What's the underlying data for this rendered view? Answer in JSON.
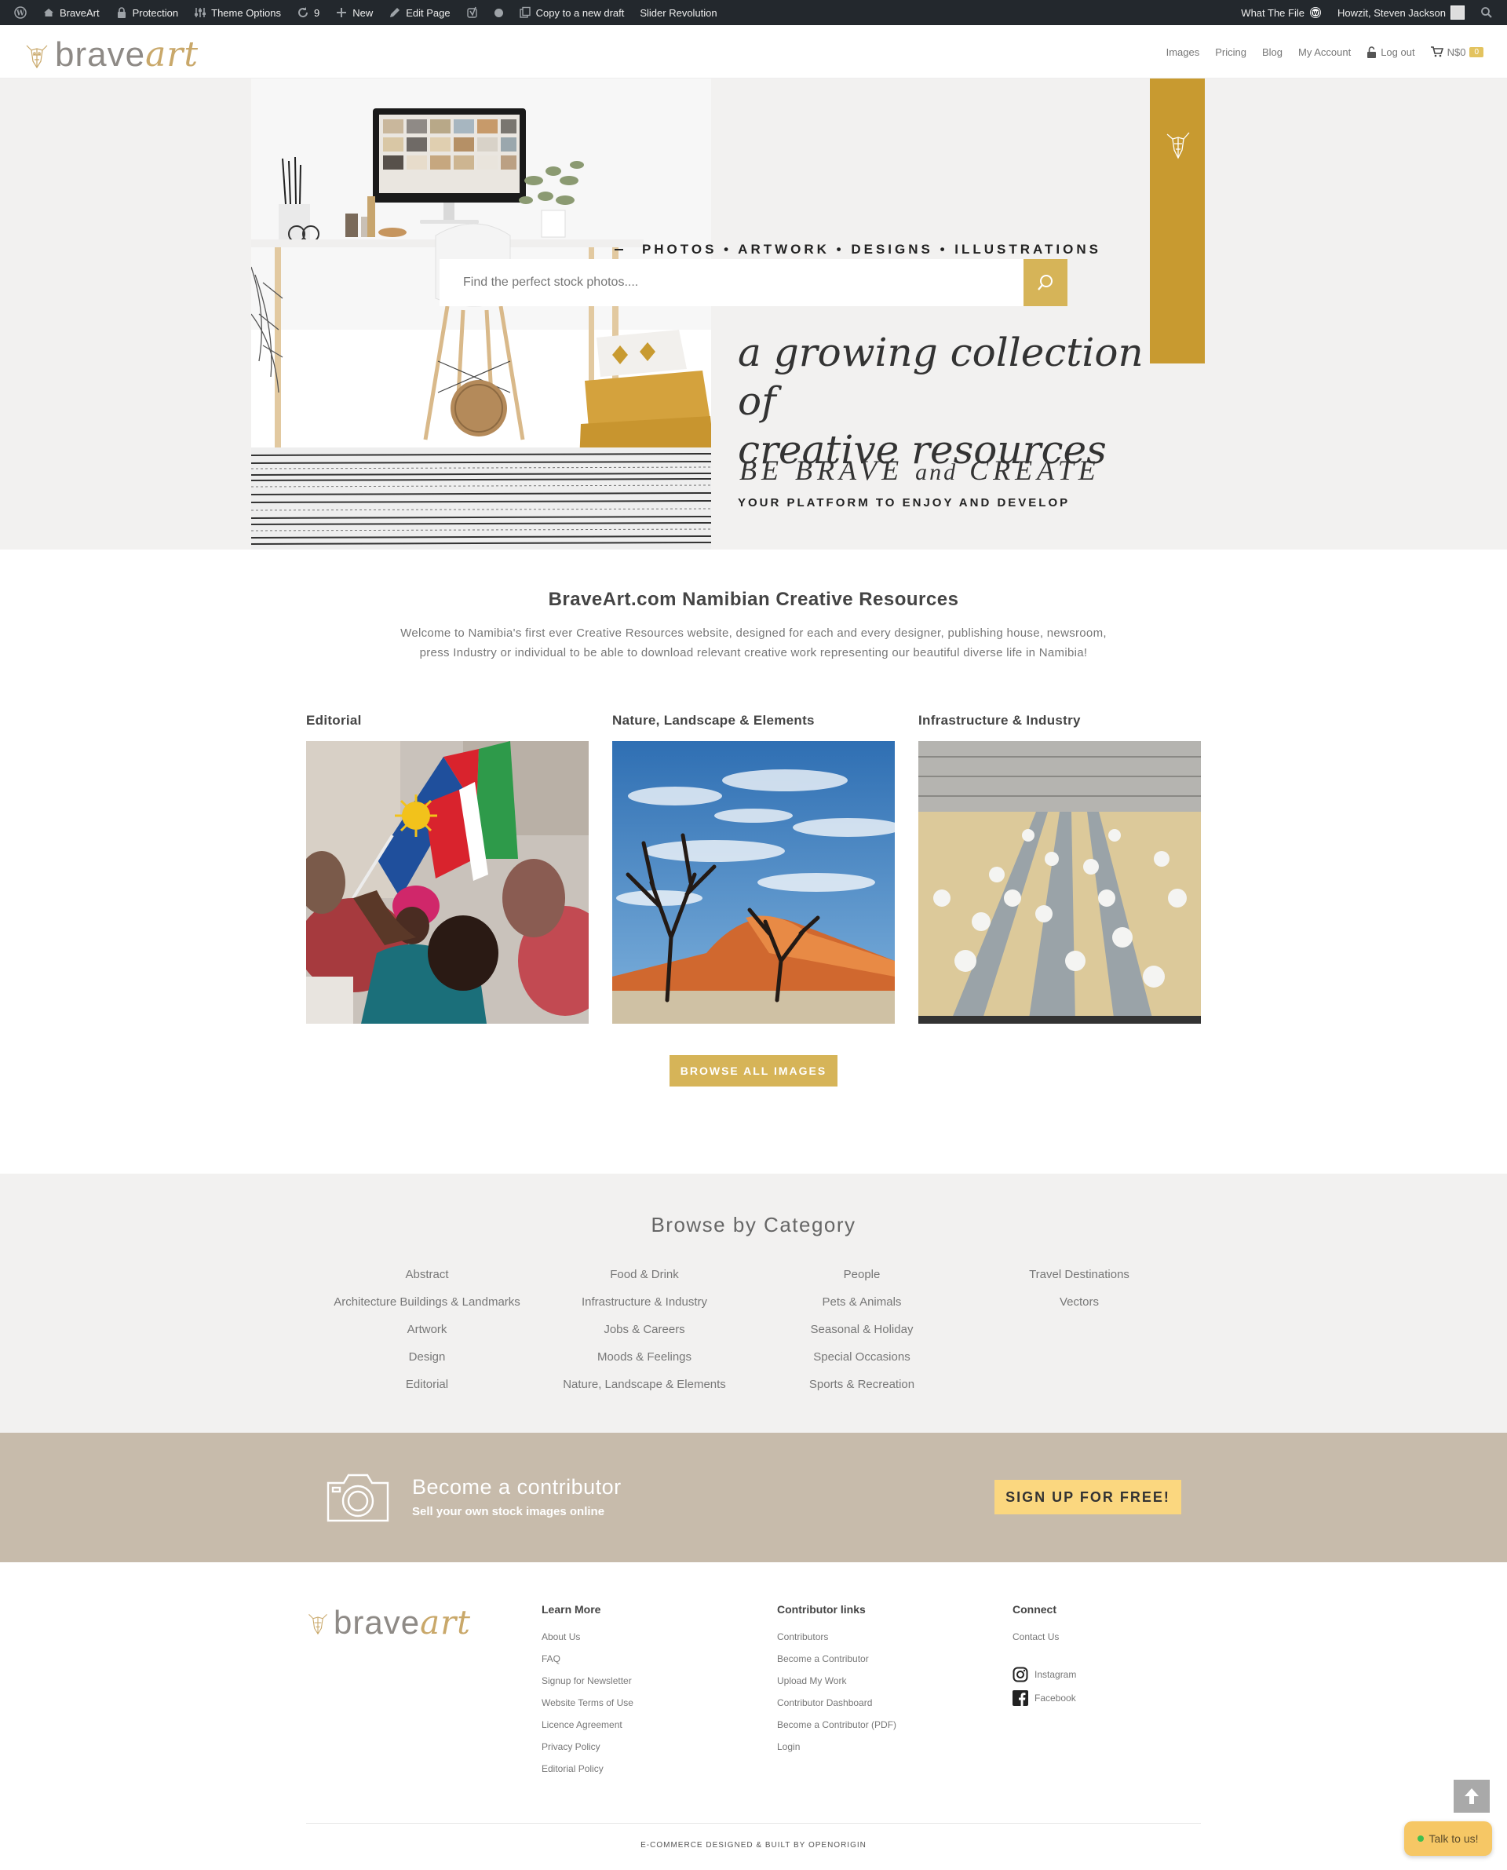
{
  "adminbar": {
    "left": [
      {
        "icon": "wordpress-icon",
        "label": ""
      },
      {
        "icon": "home-icon",
        "label": "BraveArt"
      },
      {
        "icon": "lock-icon",
        "label": "Protection"
      },
      {
        "icon": "sliders-icon",
        "label": "Theme Options"
      },
      {
        "icon": "refresh-icon",
        "label": "9"
      },
      {
        "icon": "plus-icon",
        "label": "New"
      },
      {
        "icon": "pencil-icon",
        "label": "Edit Page"
      },
      {
        "icon": "yoast-icon",
        "label": ""
      },
      {
        "icon": "status-dot-icon",
        "label": ""
      },
      {
        "icon": "copy-icon",
        "label": "Copy to a new draft"
      },
      {
        "icon": "",
        "label": "Slider Revolution"
      }
    ],
    "right": {
      "whatthefile": "What The File",
      "greeting": "Howzit, Steven Jackson"
    }
  },
  "header": {
    "logo_text_brave": "brave",
    "logo_text_art": "art",
    "nav": {
      "images": "Images",
      "pricing": "Pricing",
      "blog": "Blog",
      "account": "My Account",
      "logout": "Log out",
      "cart_total": "N$0",
      "cart_count": "0"
    }
  },
  "hero": {
    "tagline": "PHOTOS • ARTWORK • DESIGNS • ILLUSTRATIONS",
    "search_placeholder": "Find the perfect stock photos....",
    "headline_line1": "a growing collection of",
    "headline_line2": "creative resources",
    "brave_1": "BE BRAVE",
    "brave_and": "and",
    "brave_2": "CREATE",
    "platform": "YOUR PLATFORM TO ENJOY AND DEVELOP"
  },
  "intro": {
    "title": "BraveArt.com Namibian Creative Resources",
    "text": "Welcome to Namibia's first ever Creative Resources website, designed for each and every designer, publishing house, newsroom, press Industry or individual to be able to download relevant creative work representing our beautiful diverse life in Namibia!"
  },
  "featured": [
    {
      "title": "Editorial"
    },
    {
      "title": "Nature, Landscape & Elements"
    },
    {
      "title": "Infrastructure & Industry"
    }
  ],
  "browse_button": "BROWSE ALL IMAGES",
  "browse_by_category": {
    "title": "Browse by Category",
    "columns": [
      [
        "Abstract",
        "Architecture Buildings & Landmarks",
        "Artwork",
        "Design",
        "Editorial"
      ],
      [
        "Food & Drink",
        "Infrastructure & Industry",
        "Jobs & Careers",
        "Moods & Feelings",
        "Nature, Landscape & Elements"
      ],
      [
        "People",
        "Pets & Animals",
        "Seasonal & Holiday",
        "Special Occasions",
        "Sports & Recreation"
      ],
      [
        "Travel Destinations",
        "Vectors"
      ]
    ]
  },
  "contributor": {
    "title": "Become a contributor",
    "subtitle": "Sell your own stock images online",
    "button": "SIGN UP FOR FREE!"
  },
  "footer": {
    "learn_more": {
      "title": "Learn More",
      "links": [
        "About Us",
        "FAQ",
        "Signup for Newsletter",
        "Website Terms of Use",
        "Licence Agreement",
        "Privacy Policy",
        "Editorial Policy"
      ]
    },
    "contributor_links": {
      "title": "Contributor links",
      "links": [
        "Contributors",
        "Become a Contributor",
        "Upload My Work",
        "Contributor Dashboard",
        "Become a Contributor (PDF)",
        "Login"
      ]
    },
    "connect": {
      "title": "Connect",
      "contact": "Contact Us",
      "instagram": "Instagram",
      "facebook": "Facebook"
    },
    "credit": "E-COMMERCE DESIGNED & BUILT BY OPENORIGIN"
  },
  "chat": {
    "label": "Talk to us!"
  },
  "colors": {
    "gold": "#c89a30",
    "button_gold": "#d6b458",
    "contrib_bg": "#c7bbab",
    "signup_yellow": "#fbd77f"
  }
}
